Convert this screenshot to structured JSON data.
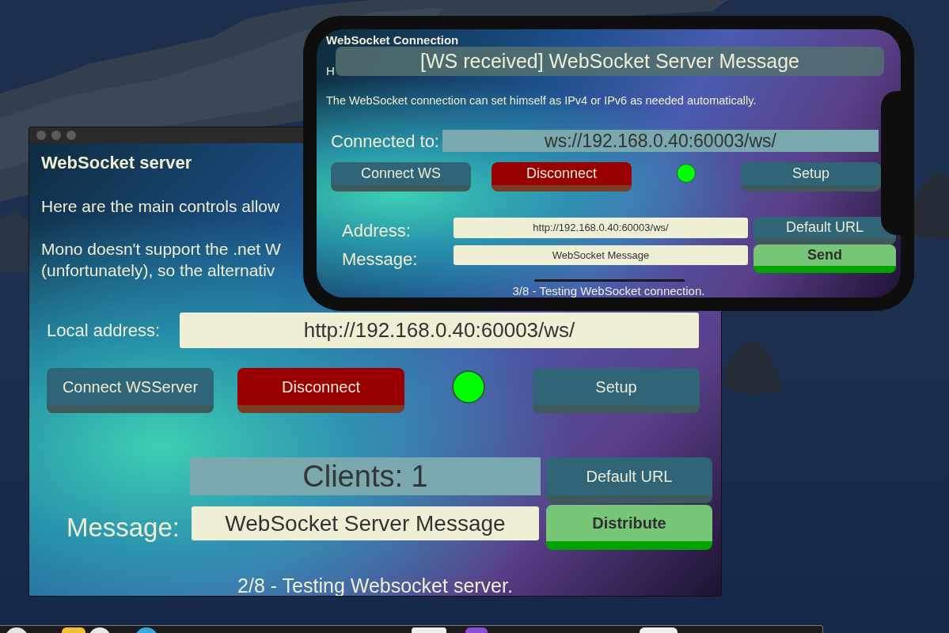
{
  "server_window": {
    "active": false,
    "title": "WebSocket server",
    "paragraphs": [
      {
        "lines": [
          "Here are the main controls allow"
        ]
      },
      {
        "lines": [
          "Mono doesn't support the .net W",
          "(unfortunately), so the alternativ"
        ]
      }
    ],
    "local_address": {
      "label": "Local address:",
      "value": "http://192.168.0.40:60003/ws/"
    },
    "controls": [
      {
        "kind": "button",
        "label": "Connect WSServer"
      },
      {
        "kind": "danger",
        "label": "Disconnect"
      },
      {
        "kind": "indicator",
        "on": true
      },
      {
        "kind": "button",
        "label": "Setup"
      }
    ],
    "clients": "Clients: 1",
    "default_url_button": "Default URL",
    "message": {
      "label": "Message:",
      "value": "WebSocket Server Message"
    },
    "distribute_button": "Distribute",
    "status": "2/8 - Testing Websocket server."
  },
  "phone": {
    "title": "WebSocket Connection",
    "toast": "[WS received] WebSocket Server Message",
    "paragraphs": [
      "H",
      "The WebSocket connection can set himself as IPv4 or IPv6 as needed automatically."
    ],
    "connected_to": {
      "label": "Connected to:",
      "value": "ws://192.168.0.40:60003/ws/"
    },
    "controls": [
      {
        "kind": "button",
        "label": "Connect WS"
      },
      {
        "kind": "danger",
        "label": "Disconnect"
      },
      {
        "kind": "indicator",
        "on": true
      },
      {
        "kind": "button",
        "label": "Setup"
      }
    ],
    "address": {
      "label": "Address:",
      "value": "http://192.168.0.40:60003/ws/"
    },
    "default_url_button": "Default URL",
    "message": {
      "label": "Message:",
      "value": "WebSocket Message"
    },
    "send_button": "Send",
    "status": "3/8 - Testing WebSocket connection."
  }
}
